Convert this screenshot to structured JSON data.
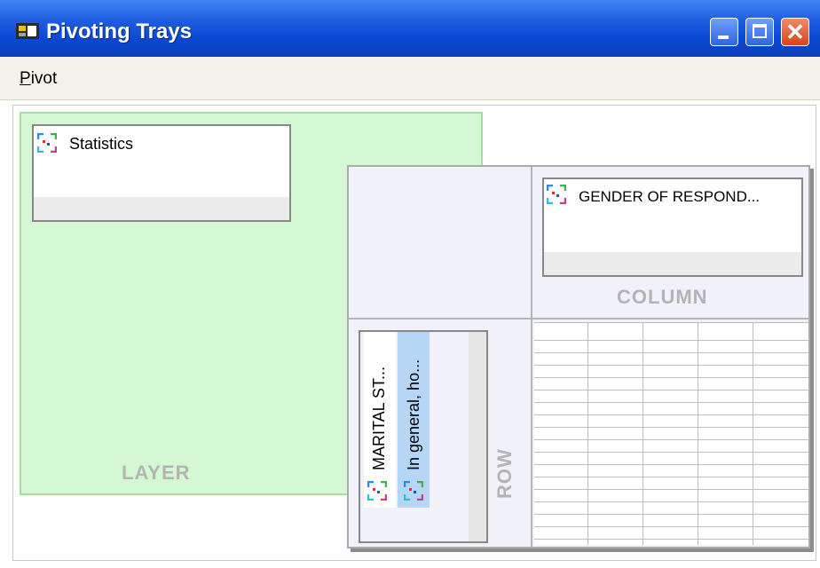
{
  "window": {
    "title": "Pivoting Trays",
    "controls": {
      "minimize": "minimize",
      "maximize": "maximize",
      "close": "✕"
    }
  },
  "menu": {
    "pivot_first": "P",
    "pivot_rest": "ivot"
  },
  "trays": {
    "layer": {
      "label": "LAYER",
      "item": "Statistics"
    },
    "column": {
      "label": "COLUMN",
      "item": "GENDER OF RESPOND..."
    },
    "row": {
      "label": "ROW",
      "items": [
        {
          "label": "MARITAL ST...",
          "selected": false
        },
        {
          "label": "In general, ho...",
          "selected": true
        }
      ]
    }
  },
  "icons": {
    "app": "pivot-app-icon",
    "pivot_item": "pivot-icon"
  },
  "colors": {
    "titlebar": "#0a48d2",
    "layer_tray": "#d4f8d4",
    "selected_item": "#b5d6f5",
    "tray_label": "#b4b4b4"
  }
}
